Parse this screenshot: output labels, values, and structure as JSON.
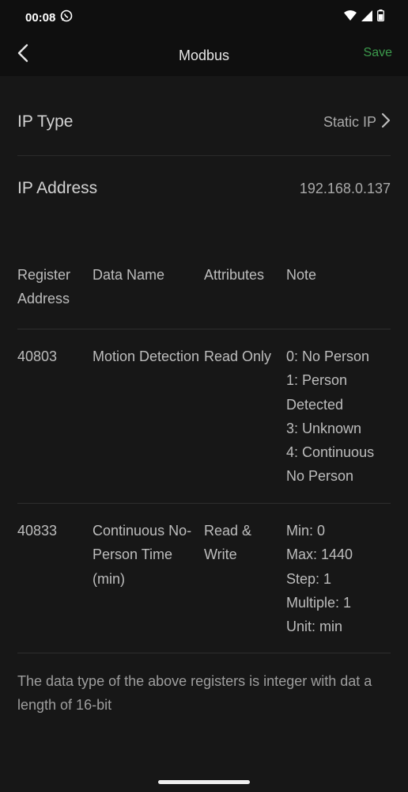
{
  "status": {
    "time": "00:08"
  },
  "appbar": {
    "title": "Modbus",
    "save_label": "Save"
  },
  "settings": [
    {
      "label": "IP Type",
      "value": "Static IP"
    },
    {
      "label": "IP Address",
      "value": "192.168.0.137"
    }
  ],
  "table": {
    "headers": [
      "Register Address",
      "Data Name",
      "Attributes",
      "Note"
    ],
    "rows": [
      {
        "address": "40803",
        "name": "Motion Detection",
        "attributes": "Read Only",
        "note": [
          "0: No Person",
          "1: Person Detected",
          "3: Unknown",
          "4: Continuous No Person"
        ]
      },
      {
        "address": "40833",
        "name": "Continuous No-Person Time (min)",
        "attributes": "Read & Write",
        "note": [
          "Min: 0",
          "Max: 1440",
          "Step: 1",
          "Multiple: 1",
          "Unit: min"
        ]
      }
    ]
  },
  "footnote": "The data type of the above registers is integer with dat a length of 16-bit",
  "colors": {
    "accent": "#3c9a4c",
    "background": "#171717",
    "bar": "#0f0f0f"
  }
}
